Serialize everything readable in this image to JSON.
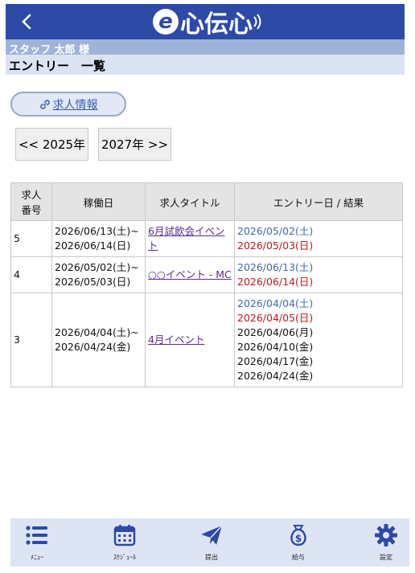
{
  "header": {
    "logo_e": "e",
    "logo_text": "心伝心",
    "back_icon": "chevron-left-icon",
    "staff_name": "スタッフ 太郎 様",
    "page_title": "エントリー　一覧"
  },
  "actions": {
    "job_info_label": "求人情報",
    "prev_year_label": "<< 2025年",
    "next_year_label": "2027年 >>"
  },
  "table": {
    "headers": [
      "求人番号",
      "稼働日",
      "求人タイトル",
      "エントリー日 / 結果"
    ],
    "header_no_lines": [
      "求人",
      "番号"
    ],
    "rows": [
      {
        "no": "5",
        "dates": [
          "2026/06/13(土)~",
          "2026/06/14(日)"
        ],
        "title": "6月試飲会イベント",
        "entries": [
          {
            "text": "2026/05/02(土)",
            "color": "blue"
          },
          {
            "text": "2026/05/03(日)",
            "color": "red"
          }
        ]
      },
      {
        "no": "4",
        "dates": [
          "2026/05/02(土)~",
          "2026/05/03(日)"
        ],
        "title": "○○イベント - MC",
        "entries": [
          {
            "text": "2026/06/13(土)",
            "color": "blue"
          },
          {
            "text": "2026/06/14(日)",
            "color": "red"
          }
        ]
      },
      {
        "no": "3",
        "dates": [
          "2026/04/04(土)~",
          "2026/04/24(金)"
        ],
        "title": "4月イベント",
        "entries": [
          {
            "text": "2026/04/04(土)",
            "color": "blue"
          },
          {
            "text": "2026/04/05(日)",
            "color": "red"
          },
          {
            "text": "2026/04/06(月)",
            "color": "black"
          },
          {
            "text": "2026/04/10(金)",
            "color": "black"
          },
          {
            "text": "2026/04/17(金)",
            "color": "black"
          },
          {
            "text": "2026/04/24(金)",
            "color": "black"
          }
        ]
      }
    ]
  },
  "nav": {
    "items": [
      {
        "label": "ﾒﾆｭｰ",
        "icon": "menu-icon"
      },
      {
        "label": "ｽｹｼﾞｭｰﾙ",
        "icon": "calendar-icon"
      },
      {
        "label": "提出",
        "icon": "paper-plane-icon"
      },
      {
        "label": "給与",
        "icon": "money-bag-icon"
      },
      {
        "label": "設定",
        "icon": "gear-icon"
      }
    ]
  },
  "colors": {
    "header_bg": "#2e4aa8",
    "staff_bar_bg": "#9fb3da",
    "title_bar_bg": "#dbe3f3",
    "nav_bg": "#dde5f4",
    "icon_color": "#2e4aa8",
    "status_blue": "#3d68b8",
    "status_red": "#c0161c"
  }
}
